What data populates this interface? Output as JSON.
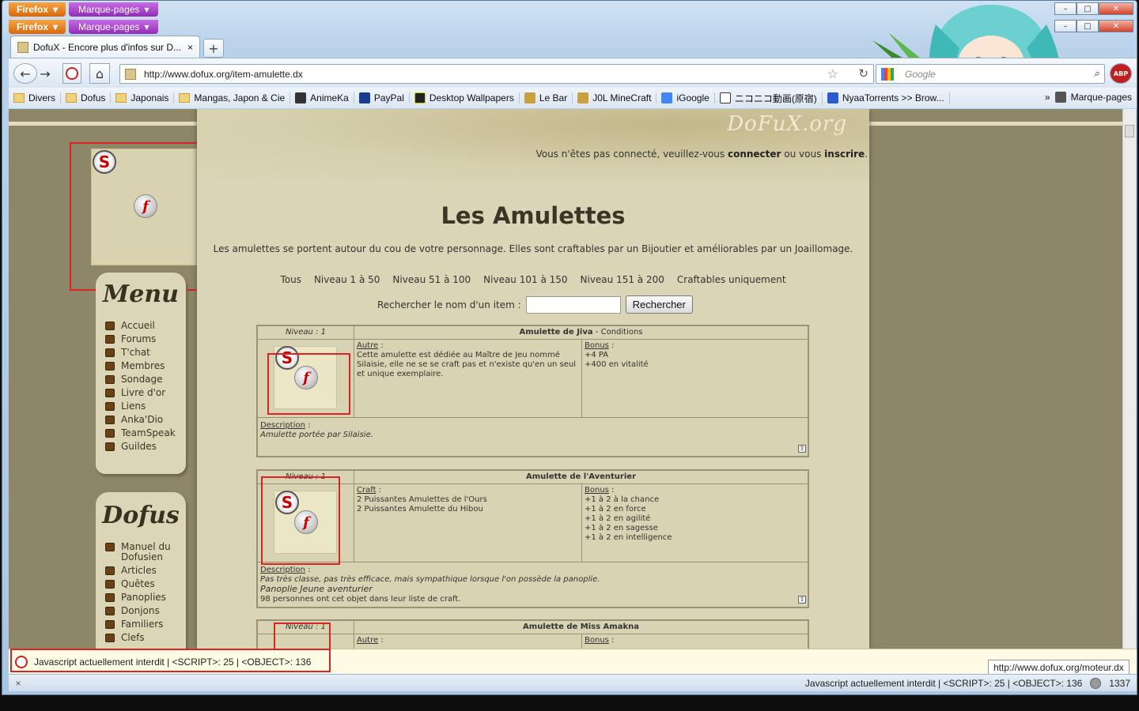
{
  "window": {
    "firefox_label": "Firefox",
    "bookmarks_menu_label": "Marque-pages",
    "minimize": "–",
    "maximize": "□",
    "close": "✕"
  },
  "tab": {
    "title": "DofuX - Encore plus d'infos sur D...",
    "close": "×",
    "new_tab": "+"
  },
  "nav": {
    "back": "←",
    "forward": "→",
    "home": "⌂",
    "url": "http://www.dofux.org/item-amulette.dx",
    "search_placeholder": "Google",
    "star": "☆",
    "reload": "↻",
    "abp": "ABP"
  },
  "bookmarks": [
    "Divers",
    "Dofus",
    "Japonais",
    "Mangas, Japon & Cie",
    "AnimeKa",
    "PayPal",
    "Desktop Wallpapers",
    "Le Bar",
    "J0L MineCraft",
    "iGoogle",
    "ニコニコ動画(原宿)",
    "NyaaTorrents >> Brow...",
    "Marque-pages"
  ],
  "page": {
    "logo": "DoFuX.org",
    "connect_text_pre": "Vous n'êtes pas connecté, veuillez-vous ",
    "connect_link": "connecter",
    "connect_mid": " ou vous ",
    "register_link": "inscrire",
    "connect_end": ".",
    "title": "Les Amulettes",
    "intro": "Les amulettes se portent autour du cou de votre personnage. Elles sont craftables par un Bijoutier et améliorables par un Joaillomage.",
    "filters": [
      "Tous",
      "Niveau 1 à 50",
      "Niveau 51 à 100",
      "Niveau 101 à 150",
      "Niveau 151 à 200",
      "Craftables uniquement"
    ],
    "search_label": "Rechercher le nom d'un item :",
    "search_button": "Rechercher"
  },
  "menu": {
    "title": "Menu",
    "items": [
      "Accueil",
      "Forums",
      "T'chat",
      "Membres",
      "Sondage",
      "Livre d'or",
      "Liens",
      "Anka'Dio",
      "TeamSpeak",
      "Guildes"
    ]
  },
  "dofus_menu": {
    "title": "Dofus",
    "items": [
      "Manuel du Dofusien",
      "Articles",
      "Quêtes",
      "Panoplies",
      "Donjons",
      "Familiers",
      "Clefs"
    ]
  },
  "items": [
    {
      "level": "Niveau : 1",
      "name": "Amulette de Jiva",
      "name_suffix": " - Conditions",
      "left_label": "Autre",
      "left_text": "Cette amulette est dédiée au Maître de Jeu nommé Silaisie, elle ne se se craft pas et n'existe qu'en un seul et unique exemplaire.",
      "bonus_label": "Bonus",
      "bonus": [
        "+4 PA",
        "+400 en vitalité"
      ],
      "desc_label": "Description",
      "desc": "Amulette portée par Silaisie.",
      "extra": [
        "",
        ""
      ]
    },
    {
      "level": "Niveau : 1",
      "name": "Amulette de l'Aventurier",
      "name_suffix": "",
      "left_label": "Craft",
      "left_lines": [
        "2 Puissantes Amulettes de l'Ours",
        "2 Puissantes Amulette du Hibou"
      ],
      "bonus_label": "Bonus",
      "bonus": [
        "+1 à 2 à la chance",
        "+1 à 2 en force",
        "+1 à 2 en agilité",
        "+1 à 2 en sagesse",
        "+1 à 2 en intelligence"
      ],
      "desc_label": "Description",
      "desc": "Pas très classe, pas très efficace, mais sympathique lorsque l'on possède la panoplie.",
      "extra": [
        "Panoplie Jeune aventurier",
        "98 personnes ont cet objet dans leur liste de craft."
      ]
    },
    {
      "level": "Niveau : 1",
      "name": "Amulette de Miss Amakna",
      "left_label": "Autre",
      "bonus_label": "Bonus"
    }
  ],
  "noscript_bar": "Javascript actuellement interdit | <SCRIPT>: 25 | <OBJECT>: 136",
  "tooltip_url": "http://www.dofux.org/moteur.dx",
  "status": {
    "close": "×",
    "text": "Javascript actuellement interdit | <SCRIPT>: 25 | <OBJECT>: 136",
    "count": "1337"
  }
}
